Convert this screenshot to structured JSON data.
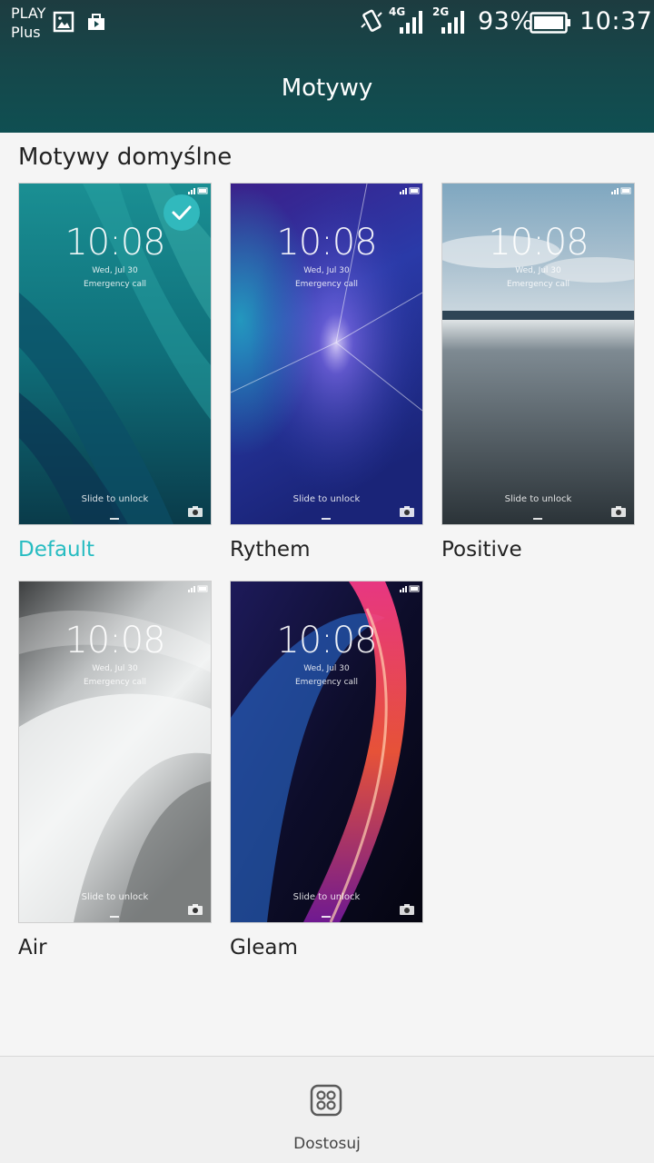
{
  "status_bar": {
    "carrier_line1": "PLAY",
    "carrier_line2": "Plus",
    "net1": "4G",
    "net2": "2G",
    "battery": "93%",
    "time": "10:37",
    "icons": [
      "image-icon",
      "store-icon",
      "vibrate-icon",
      "signal-icon",
      "signal-icon",
      "battery-icon"
    ]
  },
  "header": {
    "title": "Motywy"
  },
  "section": {
    "title": "Motywy domyślne"
  },
  "themes": [
    {
      "name": "Default",
      "selected": true,
      "time": "10:08",
      "date": "Wed, Jul 30",
      "emergency": "Emergency call",
      "slide": "Slide to unlock"
    },
    {
      "name": "Rythem",
      "selected": false,
      "time": "10:08",
      "date": "Wed, Jul 30",
      "emergency": "Emergency call",
      "slide": "Slide to unlock"
    },
    {
      "name": "Positive",
      "selected": false,
      "time": "10:08",
      "date": "Wed, Jul 30",
      "emergency": "Emergency call",
      "slide": "Slide to unlock"
    },
    {
      "name": "Air",
      "selected": false,
      "time": "10:08",
      "date": "Wed, Jul 30",
      "emergency": "Emergency call",
      "slide": "Slide to unlock"
    },
    {
      "name": "Gleam",
      "selected": false,
      "time": "10:08",
      "date": "Wed, Jul 30",
      "emergency": "Emergency call",
      "slide": "Slide to unlock"
    }
  ],
  "bottom": {
    "customize_label": "Dostosuj",
    "customize_icon": "grid-icon"
  },
  "colors": {
    "accent": "#27bcc1",
    "header": "#134a4d"
  }
}
